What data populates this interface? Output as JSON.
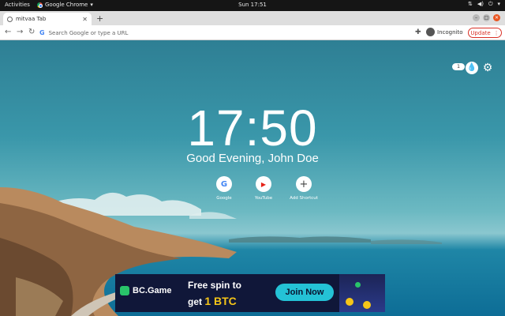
{
  "system_bar": {
    "activities": "Activities",
    "app_name": "Google Chrome",
    "clock": "Sun 17:51"
  },
  "browser": {
    "tab_title": "mitvaa Tab",
    "new_tab_symbol": "+",
    "omnibox_placeholder": "Search Google or type a URL",
    "profile_label": "Incognito",
    "update_label": "Update"
  },
  "new_tab": {
    "badge_count": "1",
    "time": "17:50",
    "greeting": "Good Evening, John Doe",
    "shortcuts": [
      {
        "label": "Google",
        "glyph": "G",
        "icon": "google-icon"
      },
      {
        "label": "YouTube",
        "glyph": "▶",
        "icon": "youtube-icon"
      },
      {
        "label": "Add Shortcut",
        "glyph": "+",
        "icon": "plus-icon"
      }
    ]
  },
  "ad": {
    "brand": "BC.Game",
    "line1": "Free spin to",
    "line2_prefix": "get ",
    "line2_highlight": "1 BTC",
    "cta": "Join Now"
  },
  "colors": {
    "update_accent": "#d93025",
    "ubuntu_close": "#e95420",
    "ad_background": "#101739",
    "ad_button": "#24c2d6",
    "ad_highlight": "#f5c518"
  }
}
